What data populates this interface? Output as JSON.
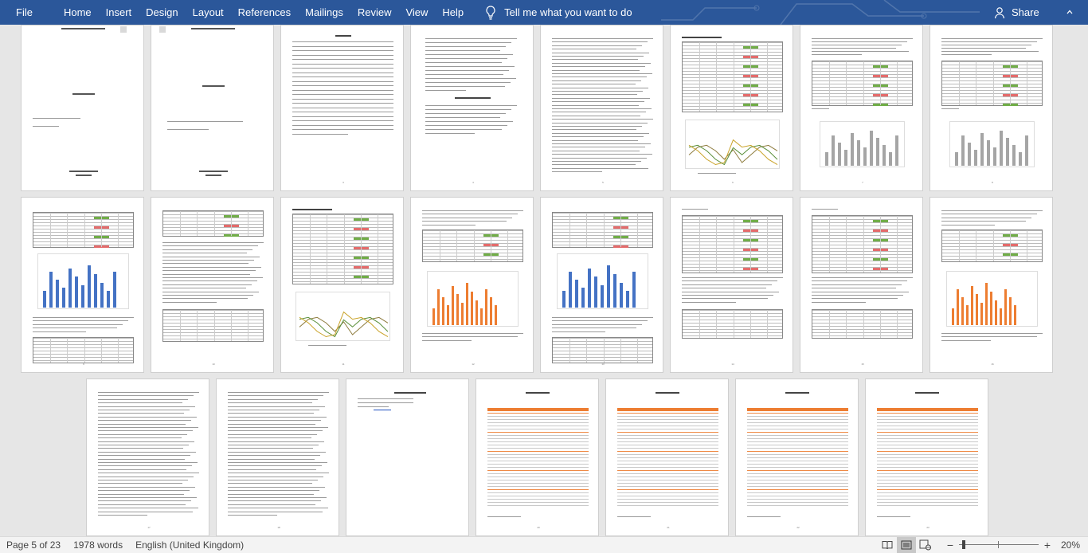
{
  "ribbon": {
    "tabs": [
      "File",
      "Home",
      "Insert",
      "Design",
      "Layout",
      "References",
      "Mailings",
      "Review",
      "View",
      "Help"
    ],
    "tell_me": "Tell me what you want to do",
    "share": "Share"
  },
  "status": {
    "page": "Page 5 of 23",
    "words": "1978 words",
    "language": "English (United Kingdom)",
    "zoom": "20%",
    "zoom_fraction": 0.2
  },
  "colors": {
    "ribbon": "#2b579a",
    "workspace": "#e6e6e6",
    "page": "#ffffff",
    "chart_orange": "#ed7d31",
    "chart_blue": "#4472c4",
    "chart_gray": "#a5a5a5",
    "table_green": "#70ad47",
    "table_red": "#e46b6b"
  },
  "pages": [
    {
      "kind": "cover",
      "n": "1"
    },
    {
      "kind": "cover2",
      "n": "2"
    },
    {
      "kind": "toc",
      "n": "3"
    },
    {
      "kind": "lists",
      "n": "4"
    },
    {
      "kind": "text",
      "n": "5"
    },
    {
      "kind": "table-linechart",
      "n": "6"
    },
    {
      "kind": "text-table-bar",
      "n": "7"
    },
    {
      "kind": "text-table-bar",
      "n": "8"
    },
    {
      "kind": "table-bar-blue",
      "n": "9"
    },
    {
      "kind": "text-table",
      "n": "10"
    },
    {
      "kind": "table-linechart",
      "n": "11"
    },
    {
      "kind": "table-bar-orange",
      "n": "12"
    },
    {
      "kind": "table-bar-blue",
      "n": "13"
    },
    {
      "kind": "table-text",
      "n": "14"
    },
    {
      "kind": "table-text",
      "n": "15"
    },
    {
      "kind": "table-bar-orange",
      "n": "16"
    },
    {
      "kind": "text",
      "n": "17"
    },
    {
      "kind": "text",
      "n": "18"
    },
    {
      "kind": "refs",
      "n": "19"
    },
    {
      "kind": "appendix",
      "n": "20"
    },
    {
      "kind": "appendix",
      "n": "21"
    },
    {
      "kind": "appendix",
      "n": "22"
    },
    {
      "kind": "appendix",
      "n": "23"
    }
  ]
}
